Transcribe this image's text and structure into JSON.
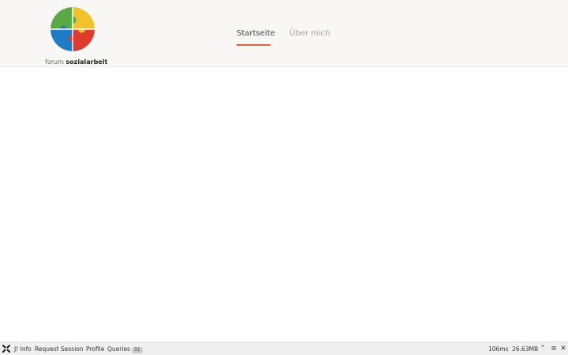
{
  "header": {
    "logo": {
      "icon": "puzzle-logo",
      "text_regular": "forum",
      "text_bold": "sozialarbeit",
      "colors": {
        "green": "#5aa846",
        "yellow": "#f2c12e",
        "blue": "#1f7cc4",
        "red": "#e03a2c"
      }
    },
    "nav": [
      {
        "label": "Startseite",
        "active": true
      },
      {
        "label": "Über mich",
        "active": false
      }
    ],
    "accent_color": "#d4634a"
  },
  "debugbar": {
    "items": {
      "info": "J! Info",
      "request": "Request",
      "session": "Session",
      "profile": "Profile",
      "queries": "Queries",
      "queries_count": "31"
    },
    "time": "106ms",
    "memory": "26.63MB",
    "icons": [
      "joomla-icon",
      "chevron-up-icon",
      "menu-icon",
      "close-icon"
    ]
  }
}
